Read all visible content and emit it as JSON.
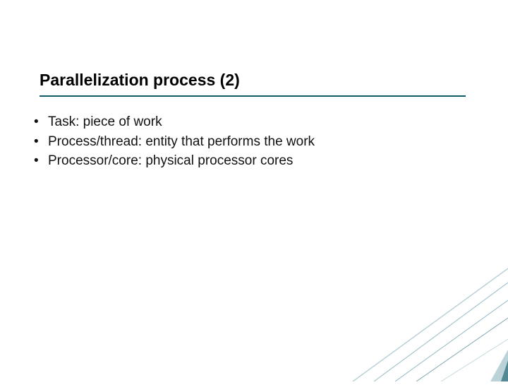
{
  "title": "Parallelization process (2)",
  "bullets": [
    "Task: piece of work",
    "Process/thread: entity that performs the work",
    "Processor/core: physical processor cores"
  ]
}
